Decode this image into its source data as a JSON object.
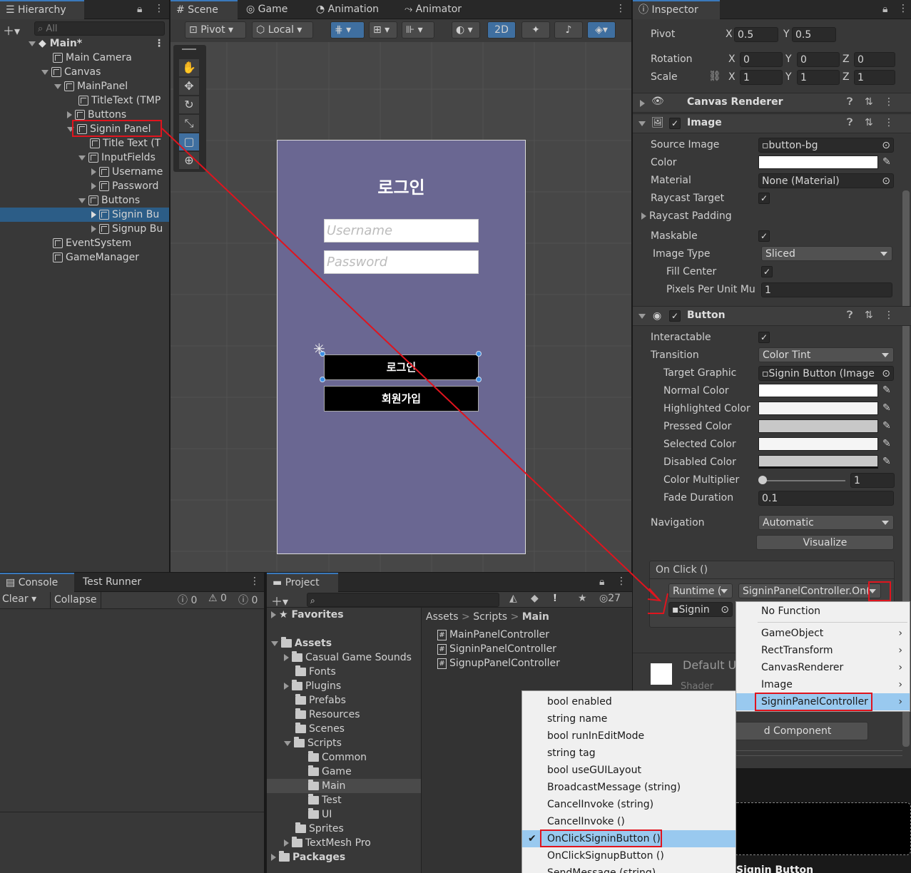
{
  "hierarchy": {
    "tab": "Hierarchy",
    "search_placeholder": "All",
    "scene": "Main*",
    "items": [
      "Main Camera",
      "Canvas",
      "MainPanel",
      "TitleText (TMP",
      "Buttons",
      "Signin Panel",
      "Title Text (T",
      "InputFields",
      "Username",
      "Password",
      "Buttons",
      "Signin Bu",
      "Signup Bu",
      "EventSystem",
      "GameManager"
    ]
  },
  "scene": {
    "tabs": [
      "Scene",
      "Game",
      "Animation",
      "Animator"
    ],
    "toolbar": {
      "pivot": "Pivot",
      "local": "Local",
      "mode_2d": "2D"
    },
    "canvas": {
      "title": "로그인",
      "username_ph": "Username",
      "password_ph": "Password",
      "btn_login": "로그인",
      "btn_signup": "회원가입"
    }
  },
  "inspector": {
    "tab": "Inspector",
    "pivot": {
      "label": "Pivot",
      "x": "0.5",
      "y": "0.5"
    },
    "rotation": {
      "label": "Rotation",
      "x": "0",
      "y": "0",
      "z": "0"
    },
    "scale": {
      "label": "Scale",
      "x": "1",
      "y": "1",
      "z": "1"
    },
    "axis": {
      "x": "X",
      "y": "Y",
      "z": "Z"
    },
    "canvas_renderer": "Canvas Renderer",
    "image": {
      "header": "Image",
      "source_image_label": "Source Image",
      "source_image": "button-bg",
      "color_label": "Color",
      "material_label": "Material",
      "material": "None (Material)",
      "raycast_target": "Raycast Target",
      "raycast_padding": "Raycast Padding",
      "maskable": "Maskable",
      "image_type_label": "Image Type",
      "image_type": "Sliced",
      "fill_center": "Fill Center",
      "ppu_label": "Pixels Per Unit Mu",
      "ppu": "1"
    },
    "button": {
      "header": "Button",
      "interactable": "Interactable",
      "transition_label": "Transition",
      "transition": "Color Tint",
      "target_graphic_label": "Target Graphic",
      "target_graphic": "Signin Button (Image",
      "normal": "Normal Color",
      "highlighted": "Highlighted Color",
      "pressed": "Pressed Color",
      "selected": "Selected Color",
      "disabled": "Disabled Color",
      "multiplier_label": "Color Multiplier",
      "multiplier": "1",
      "fade_label": "Fade Duration",
      "fade": "0.1",
      "navigation_label": "Navigation",
      "navigation": "Automatic",
      "visualize": "Visualize"
    },
    "onclick": {
      "header": "On Click ()",
      "runtime": "Runtime (",
      "function": "SigninPanelController.On(",
      "object": "Signin"
    },
    "default_ui": "Default U",
    "shader": "Shader",
    "add_component": "d Component",
    "preview_label": "Signin Button"
  },
  "console": {
    "tabs": [
      "Console",
      "Test Runner"
    ],
    "clear": "Clear",
    "collapse": "Collapse",
    "counts": [
      "0",
      "0",
      "0"
    ]
  },
  "project": {
    "tab": "Project",
    "count": "27",
    "tree": [
      "Favorites",
      "Assets",
      "Casual Game Sounds",
      "Fonts",
      "Plugins",
      "Prefabs",
      "Resources",
      "Scenes",
      "Scripts",
      "Common",
      "Game",
      "Main",
      "Test",
      "UI",
      "Sprites",
      "TextMesh Pro",
      "Packages"
    ],
    "breadcrumb": [
      "Assets",
      "Scripts",
      "Main"
    ],
    "files": [
      "MainPanelController",
      "SigninPanelController",
      "SignupPanelController"
    ]
  },
  "menu_components": {
    "items": [
      "No Function",
      "GameObject",
      "RectTransform",
      "CanvasRenderer",
      "Image",
      "SigninPanelController"
    ]
  },
  "menu_methods": {
    "items": [
      "bool enabled",
      "string name",
      "bool runInEditMode",
      "string tag",
      "bool useGUILayout",
      "BroadcastMessage (string)",
      "CancelInvoke (string)",
      "CancelInvoke ()",
      "OnClickSigninButton ()",
      "OnClickSignupButton ()",
      "SendMessage (string)"
    ]
  }
}
